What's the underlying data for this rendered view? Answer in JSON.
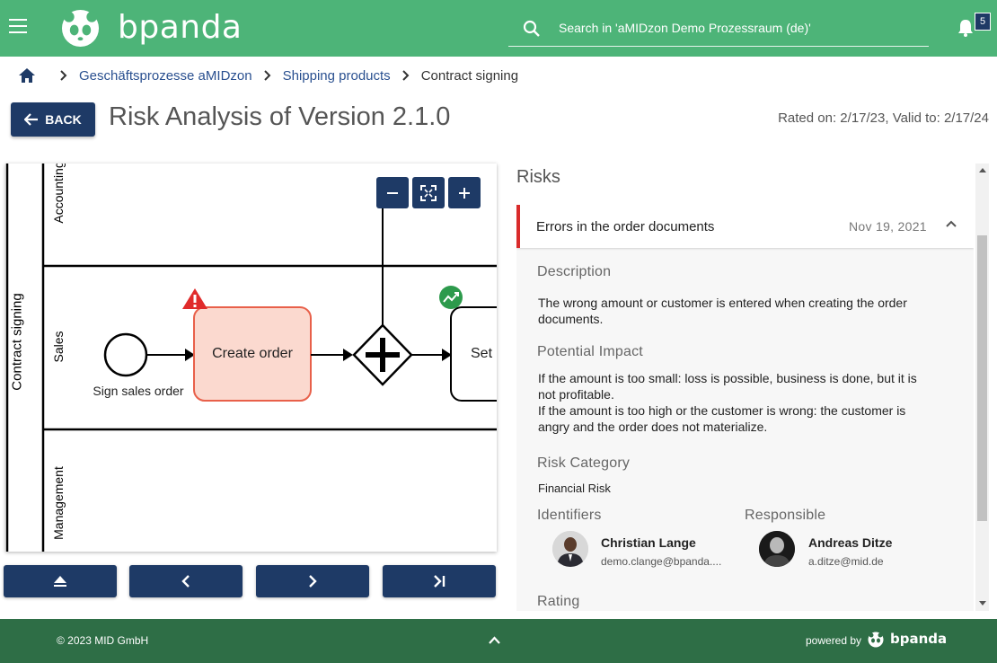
{
  "header": {
    "brand": "bpanda",
    "search_placeholder": "Search in 'aMIDzon Demo Prozessraum (de)'",
    "notification_count": "5",
    "colors": {
      "bar": "#4db478",
      "badge": "#1e3a66"
    }
  },
  "breadcrumb": {
    "items": [
      {
        "label": "Geschäftsprozesse aMIDzon"
      },
      {
        "label": "Shipping products"
      },
      {
        "label": "Contract signing"
      }
    ]
  },
  "title_row": {
    "back_label": "BACK",
    "title": "Risk Analysis of Version 2.1.0",
    "rating_info": "Rated on: 2/17/23, Valid to: 2/17/24"
  },
  "diagram": {
    "pool_label": "Contract signing",
    "lanes": [
      "Accounting",
      "Sales",
      "Management"
    ],
    "start_event_label": "Sign sales order",
    "task_label": "Create order",
    "next_task_label": "Set",
    "icons": [
      "warning-icon",
      "trend-up-icon"
    ],
    "zoom": [
      "zoom-out-icon",
      "fit-screen-icon",
      "zoom-in-icon"
    ],
    "nav": [
      "eject-icon",
      "chevron-left-icon",
      "chevron-right-icon",
      "skip-to-end-icon"
    ]
  },
  "risks": {
    "title": "Risks",
    "accent": "#d92b2b",
    "item": {
      "title": "Errors in the order documents",
      "date": "Nov 19, 2021",
      "description_label": "Description",
      "description": "The wrong amount or customer is entered when creating the order documents.",
      "impact_label": "Potential Impact",
      "impact_lines": [
        "If the amount is too small: loss is possible, business is done, but it is not profitable.",
        "If the amount is too high or the customer is wrong: the customer is angry and the order does not materialize."
      ],
      "category_label": "Risk Category",
      "category": "Financial Risk",
      "identifiers_label": "Identifiers",
      "responsible_label": "Responsible",
      "identifier": {
        "name": "Christian Lange",
        "email": "demo.clange@bpanda...."
      },
      "responsible": {
        "name": "Andreas Ditze",
        "email": "a.ditze@mid.de"
      },
      "rating_label": "Rating"
    }
  },
  "footer": {
    "copyright": "© 2023 MID GmbH",
    "powered_by": "powered by",
    "brand": "bpanda"
  }
}
